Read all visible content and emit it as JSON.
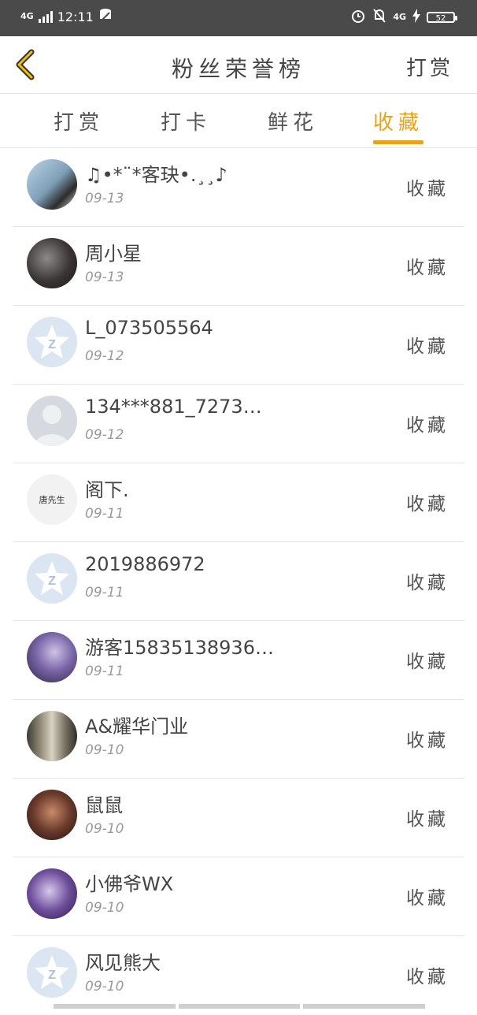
{
  "status_bar": {
    "network_left": "4G",
    "time": "12:11",
    "network_right": "4G",
    "battery": "52"
  },
  "header": {
    "title": "粉丝荣誉榜",
    "right_action": "打赏"
  },
  "tabs": [
    {
      "label": "打赏",
      "active": false
    },
    {
      "label": "打卡",
      "active": false
    },
    {
      "label": "鲜花",
      "active": false
    },
    {
      "label": "收藏",
      "active": true
    }
  ],
  "accent_color": "#e8a317",
  "list": [
    {
      "name": "♫•*¨*客玦•.¸¸♪",
      "date": "09-13",
      "action": "收藏",
      "avatar": "photo-girl"
    },
    {
      "name": "周小星",
      "date": "09-13",
      "action": "收藏",
      "avatar": "photo-dark"
    },
    {
      "name": "L_073505564",
      "date": "09-12",
      "action": "收藏",
      "avatar": "qq-default"
    },
    {
      "name": "134***881_7273…",
      "date": "09-12",
      "action": "收藏",
      "avatar": "person-default"
    },
    {
      "name": "阁下.",
      "date": "09-11",
      "action": "收藏",
      "avatar": "text-avatar",
      "avatar_text": "唐先生"
    },
    {
      "name": "2019886972",
      "date": "09-11",
      "action": "收藏",
      "avatar": "qq-default"
    },
    {
      "name": "游客15835138936…",
      "date": "09-11",
      "action": "收藏",
      "avatar": "photo-purple"
    },
    {
      "name": "A&耀华门业",
      "date": "09-10",
      "action": "收藏",
      "avatar": "photo-door"
    },
    {
      "name": "鼠鼠",
      "date": "09-10",
      "action": "收藏",
      "avatar": "photo-woman"
    },
    {
      "name": "小佛爷WX",
      "date": "09-10",
      "action": "收藏",
      "avatar": "photo-anime"
    },
    {
      "name": "风见熊大",
      "date": "09-10",
      "action": "收藏",
      "avatar": "qq-default"
    }
  ]
}
